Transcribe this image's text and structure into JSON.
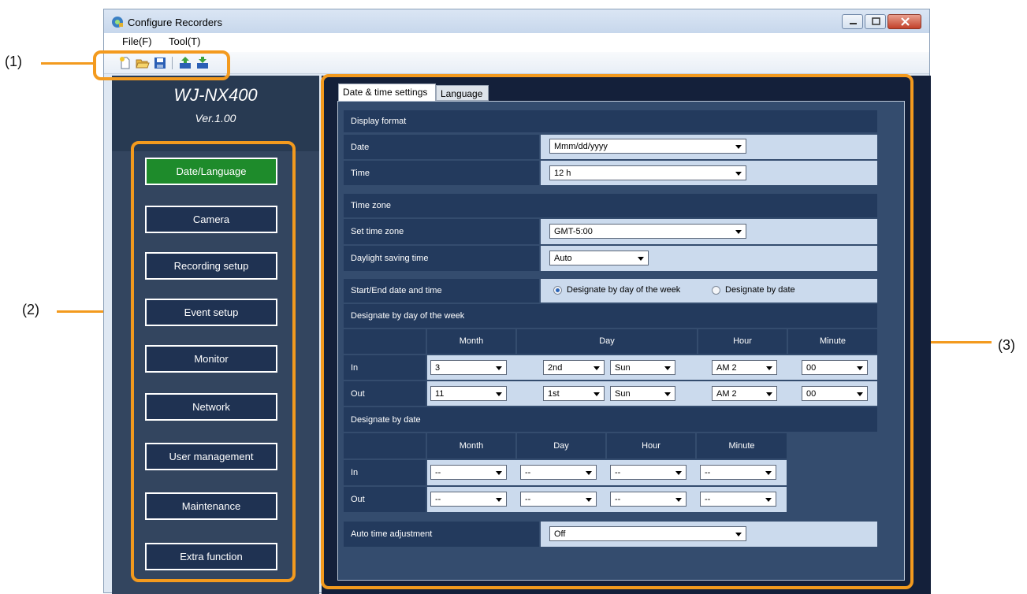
{
  "callouts": {
    "c1": "(1)",
    "c2": "(2)",
    "c3": "(3)"
  },
  "window": {
    "title": "Configure Recorders"
  },
  "menu": {
    "file": "File(F)",
    "tool": "Tool(T)"
  },
  "toolbar_icons": [
    "new-file-icon",
    "open-folder-icon",
    "save-icon",
    "upload-recorder-icon",
    "download-recorder-icon"
  ],
  "model": {
    "name": "WJ-NX400",
    "version": "Ver.1.00"
  },
  "nav": [
    {
      "label": "Date/Language",
      "active": true
    },
    {
      "label": "Camera"
    },
    {
      "label": "Recording setup"
    },
    {
      "label": "Event setup"
    },
    {
      "label": "Monitor"
    },
    {
      "label": "Network"
    },
    {
      "label": "User management"
    },
    {
      "label": "Maintenance"
    },
    {
      "label": "Extra function"
    }
  ],
  "tabs": {
    "date_time": "Date & time settings",
    "language": "Language"
  },
  "display_format": {
    "header": "Display format",
    "date_label": "Date",
    "date_value": "Mmm/dd/yyyy",
    "time_label": "Time",
    "time_value": "12 h"
  },
  "time_zone": {
    "header": "Time zone",
    "set_label": "Set time zone",
    "set_value": "GMT-5:00",
    "dst_label": "Daylight saving time",
    "dst_value": "Auto"
  },
  "start_end": {
    "label": "Start/End date and time",
    "opt_week": "Designate by day of the week",
    "opt_date": "Designate by date",
    "selected": "week"
  },
  "by_week": {
    "header": "Designate by day of the week",
    "col_month": "Month",
    "col_day": "Day",
    "col_hour": "Hour",
    "col_minute": "Minute",
    "in": {
      "label": "In",
      "month": "3",
      "week": "2nd",
      "day": "Sun",
      "hour": "AM 2",
      "minute": "00"
    },
    "out": {
      "label": "Out",
      "month": "11",
      "week": "1st",
      "day": "Sun",
      "hour": "AM 2",
      "minute": "00"
    }
  },
  "by_date": {
    "header": "Designate by date",
    "col_month": "Month",
    "col_day": "Day",
    "col_hour": "Hour",
    "col_minute": "Minute",
    "in": {
      "label": "In",
      "month": "--",
      "day": "--",
      "hour": "--",
      "minute": "--"
    },
    "out": {
      "label": "Out",
      "month": "--",
      "day": "--",
      "hour": "--",
      "minute": "--"
    }
  },
  "auto_adjust": {
    "label": "Auto time adjustment",
    "value": "Off"
  }
}
